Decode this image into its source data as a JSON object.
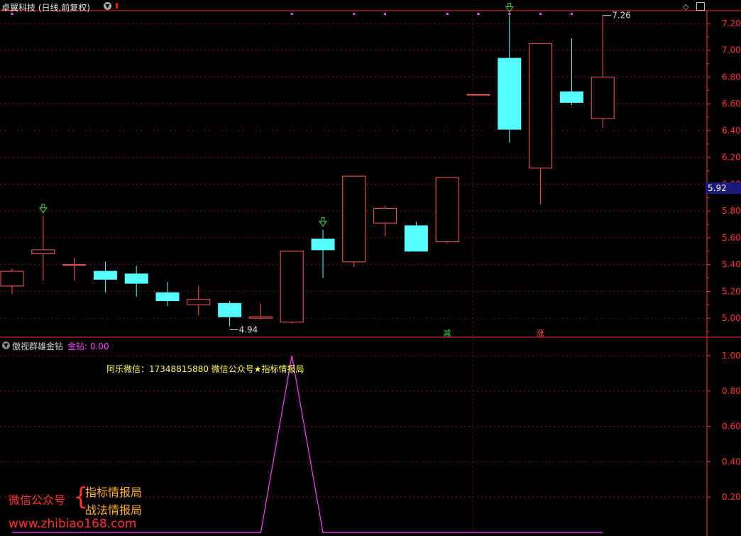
{
  "header": {
    "title": "卓翼科技 (日线,前复权)",
    "chevron_icon": "chevron-down-icon",
    "arrow_icon": "red-up-arrow-icon",
    "diamond_icon": "diamond-icon",
    "window_icon": "window-toggle-icon"
  },
  "price_badge": "5.92",
  "colors": {
    "up": "#ff5a5a",
    "down": "#55ffff",
    "grid": "#7a1010",
    "axis": "#ff3030",
    "indicator": "#ff40ff",
    "marker": "#ff40ff",
    "signal_arrow": "#44dd44"
  },
  "indicator": {
    "name": "傲视群雄金钻",
    "value_label": "金钻: 0.00",
    "info_text": "阿乐微信：17348815880    微信公众号★指标情报局"
  },
  "watermark": {
    "label": "微信公众号",
    "line1": "指标情报局",
    "line2": "战法情报局",
    "url": "www.zhibiao168.com"
  },
  "chart_data": [
    {
      "type": "candlestick",
      "ylim": [
        4.9,
        7.3
      ],
      "yticks": [
        "7.20",
        "7.00",
        "6.80",
        "6.60",
        "6.40",
        "6.20",
        "6.00",
        "5.80",
        "5.60",
        "5.40",
        "5.20",
        "5.00"
      ],
      "grid": true,
      "candles": [
        {
          "open": 5.24,
          "close": 5.35,
          "high": 5.37,
          "low": 5.18
        },
        {
          "open": 5.48,
          "close": 5.51,
          "high": 5.76,
          "low": 5.28
        },
        {
          "open": 5.4,
          "close": 5.4,
          "high": 5.45,
          "low": 5.28
        },
        {
          "open": 5.35,
          "close": 5.29,
          "high": 5.42,
          "low": 5.19
        },
        {
          "open": 5.33,
          "close": 5.26,
          "high": 5.39,
          "low": 5.16
        },
        {
          "open": 5.19,
          "close": 5.13,
          "high": 5.27,
          "low": 5.09
        },
        {
          "open": 5.1,
          "close": 5.14,
          "high": 5.24,
          "low": 5.02
        },
        {
          "open": 5.11,
          "close": 5.01,
          "high": 5.13,
          "low": 4.94
        },
        {
          "open": 5.0,
          "close": 5.01,
          "high": 5.11,
          "low": 4.99
        },
        {
          "open": 4.97,
          "close": 5.5,
          "high": 5.5,
          "low": 4.96
        },
        {
          "open": 5.59,
          "close": 5.51,
          "high": 5.66,
          "low": 5.3
        },
        {
          "open": 5.42,
          "close": 6.06,
          "high": 6.06,
          "low": 5.38
        },
        {
          "open": 5.71,
          "close": 5.82,
          "high": 5.84,
          "low": 5.61
        },
        {
          "open": 5.69,
          "close": 5.5,
          "high": 5.72,
          "low": 5.5
        },
        {
          "open": 5.57,
          "close": 6.05,
          "high": 6.05,
          "low": 5.56
        },
        {
          "open": 6.67,
          "close": 6.67,
          "high": 6.67,
          "low": 6.67
        },
        {
          "open": 6.94,
          "close": 6.41,
          "high": 7.26,
          "low": 6.31
        },
        {
          "open": 6.12,
          "close": 7.05,
          "high": 7.05,
          "low": 5.85
        },
        {
          "open": 6.69,
          "close": 6.61,
          "high": 7.09,
          "low": 6.59
        },
        {
          "open": 6.49,
          "close": 6.8,
          "high": 7.26,
          "low": 6.42
        }
      ],
      "annotations": [
        {
          "text": "4.94",
          "candle": 7,
          "price": 4.94
        },
        {
          "text": "7.26",
          "candle": 19,
          "price": 7.26
        }
      ],
      "signal_arrows": [
        1,
        10,
        16
      ],
      "top_markers": [
        0,
        9,
        11,
        12,
        14,
        15,
        16,
        17,
        18
      ],
      "tags": [
        {
          "text": "减",
          "candle": 14,
          "color": "#44dd44"
        },
        {
          "text": "涨",
          "candle": 17,
          "color": "#ff5050"
        }
      ]
    },
    {
      "type": "line",
      "name": "金钻",
      "ylim": [
        0,
        1
      ],
      "yticks": [
        "1.00",
        "0.80",
        "0.60",
        "0.40",
        "0.20"
      ],
      "grid": true,
      "values": [
        0,
        0,
        0,
        0,
        0,
        0,
        0,
        0,
        0,
        1,
        0,
        0,
        0,
        0,
        0,
        0,
        0,
        0,
        0,
        0
      ]
    }
  ]
}
